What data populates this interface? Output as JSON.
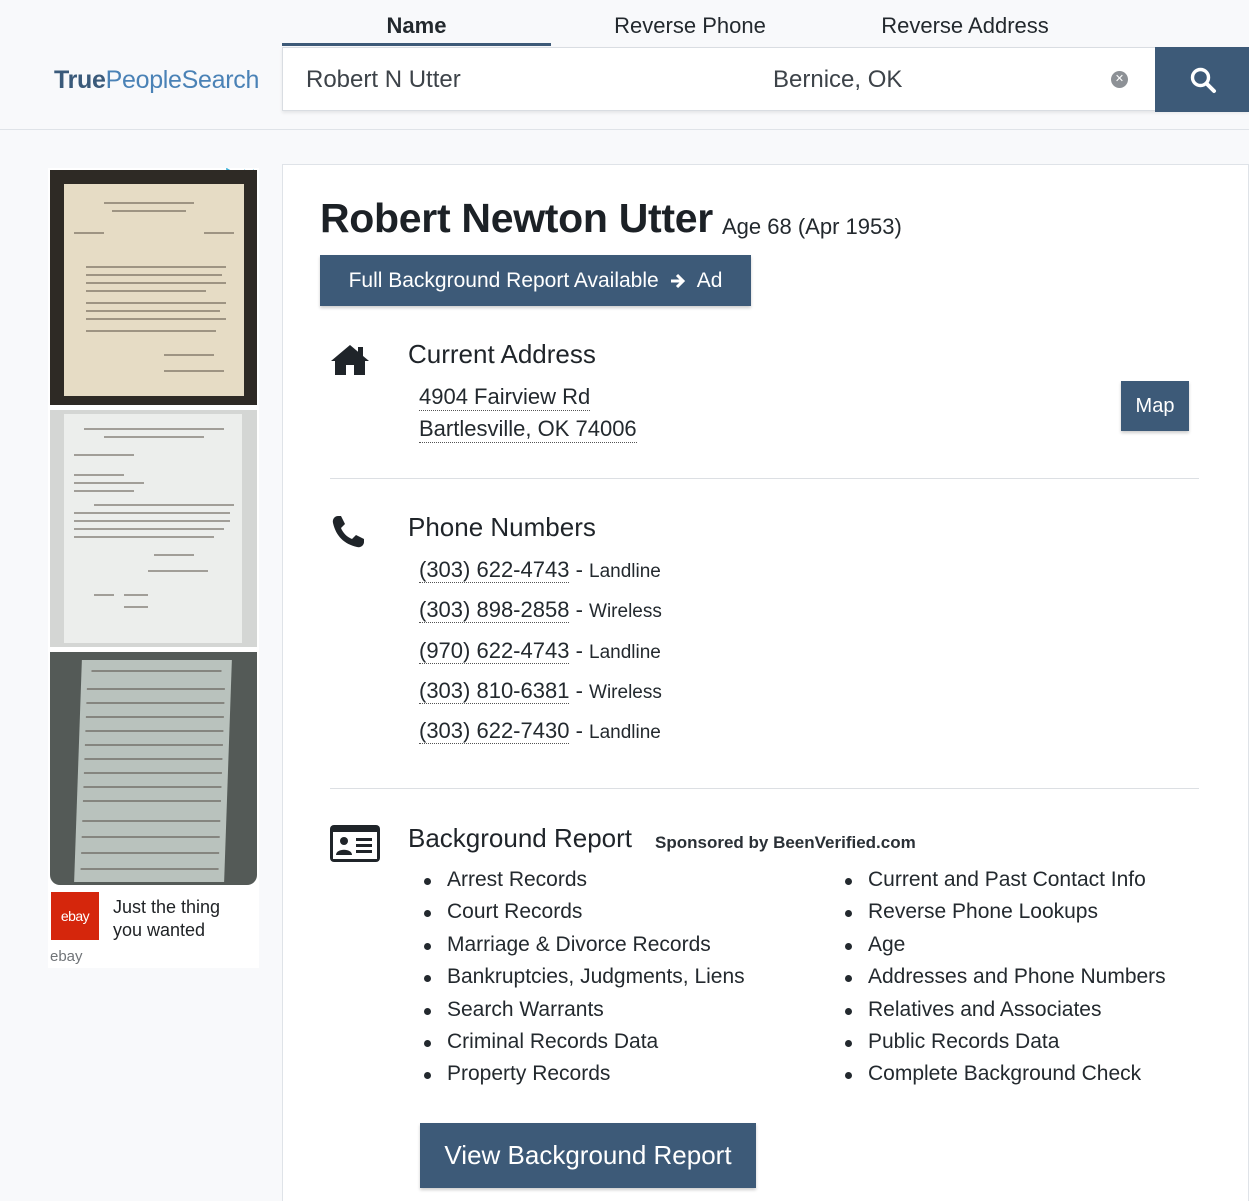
{
  "header": {
    "logo": {
      "part1": "True",
      "part2": "PeopleSearch"
    },
    "tabs": [
      {
        "label": "Name",
        "active": true
      },
      {
        "label": "Reverse Phone",
        "active": false
      },
      {
        "label": "Reverse Address",
        "active": false
      }
    ],
    "search": {
      "name_value": "Robert N Utter",
      "location_value": "Bernice, OK",
      "clear_glyph": "✕",
      "search_icon": "search-icon"
    }
  },
  "ad": {
    "text": "Just the thing you wanted",
    "logo_text": "ebay",
    "brand": "ebay",
    "icons": [
      "adchoices-icon",
      "close-icon"
    ]
  },
  "person": {
    "name": "Robert Newton Utter",
    "age": "Age 68 (Apr 1953)",
    "report_button": {
      "label": "Full Background Report Available",
      "suffix": "Ad"
    }
  },
  "address": {
    "title": "Current Address",
    "line1": "4904 Fairview Rd",
    "line2": "Bartlesville, OK 74006",
    "map_label": "Map",
    "icon": "home-icon"
  },
  "phones": {
    "title": "Phone Numbers",
    "icon": "phone-icon",
    "items": [
      {
        "number": "(303) 622-4743",
        "type": "Landline"
      },
      {
        "number": "(303) 898-2858",
        "type": "Wireless"
      },
      {
        "number": "(970) 622-4743",
        "type": "Landline"
      },
      {
        "number": "(303) 810-6381",
        "type": "Wireless"
      },
      {
        "number": "(303) 622-7430",
        "type": "Landline"
      }
    ]
  },
  "background": {
    "title": "Background Report",
    "sponsor": "Sponsored by BeenVerified.com",
    "icon": "id-card-icon",
    "left_items": [
      "Arrest Records",
      "Court Records",
      "Marriage & Divorce Records",
      "Bankruptcies, Judgments, Liens",
      "Search Warrants",
      "Criminal Records Data",
      "Property Records"
    ],
    "right_items": [
      "Current and Past Contact Info",
      "Reverse Phone Lookups",
      "Age",
      "Addresses and Phone Numbers",
      "Relatives and Associates",
      "Public Records Data",
      "Complete Background Check"
    ],
    "view_button": "View Background Report"
  },
  "colors": {
    "accent": "#3d5a78",
    "logo_dark": "#3a5a7a",
    "logo_light": "#4a82b6",
    "ebay_red": "#d5260c"
  }
}
